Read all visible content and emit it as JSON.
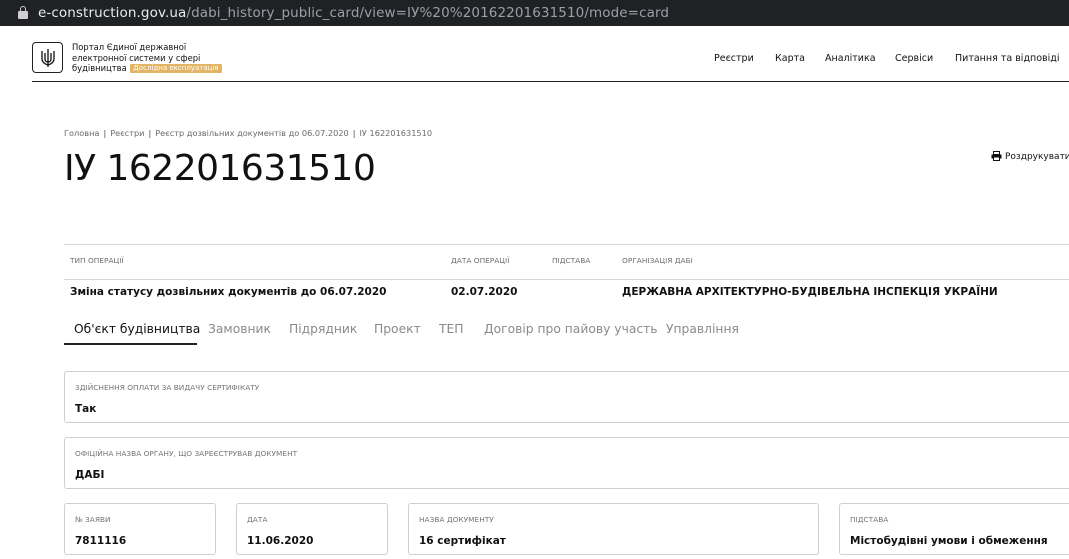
{
  "browser": {
    "url_host": "e-construction.gov.ua",
    "url_path": "/dabi_history_public_card/view=ІУ%20%2016220163151​0/mode=card"
  },
  "header": {
    "brand_line1": "Портал Єдиної державної",
    "brand_line2": "електронної системи у сфері",
    "brand_line3": "будівництва",
    "badge": "Дослідна експлуатація",
    "nav": [
      "Реєстри",
      "Карта",
      "Аналітика",
      "Сервіси",
      "Питання та відповіді"
    ]
  },
  "breadcrumbs": [
    "Головна",
    "Реєстри",
    "Реєстр дозвільних документів до 06.07.2020",
    "ІУ 162201631510"
  ],
  "page_title": "ІУ 162201631510",
  "print_label": "Роздрукувати",
  "operation": {
    "headers": [
      "ТИП ОПЕРАЦІЇ",
      "ДАТА ОПЕРАЦІЇ",
      "ПІДСТАВА",
      "ОРГАНІЗАЦІЯ ДАБІ"
    ],
    "type": "Зміна статусу дозвільних документів до 06.07.2020",
    "date": "02.07.2020",
    "basis": "",
    "organization": "ДЕРЖАВНА АРХІТЕКТУРНО-БУДІВЕЛЬНА ІНСПЕКЦІЯ УКРАЇНИ"
  },
  "tabs": [
    "Об'єкт будівництва",
    "Замовник",
    "Підрядник",
    "Проект",
    "ТЕП",
    "Договір про пайову участь",
    "Управління"
  ],
  "fields": {
    "payment_label": "ЗДІЙСНЕННЯ ОПЛАТИ ЗА ВИДАЧУ СЕРТИФІКАТУ",
    "payment_value": "Так",
    "authority_label": "ОФІЦІЙНА НАЗВА ОРГАНУ, ЩО ЗАРЕЄСТРУВАВ ДОКУМЕНТ",
    "authority_value": "ДАБІ",
    "app_no_label": "№ ЗАЯВИ",
    "app_no_value": "7811116",
    "date_label": "ДАТА",
    "date_value": "11.06.2020",
    "doc_name_label": "НАЗВА ДОКУМЕНТУ",
    "doc_name_value": "16 сертифікат",
    "basis_label": "ПІДСТАВА",
    "basis_value": "Містобудівні умови і обмеження"
  },
  "colors": {
    "badge": "#e2b566",
    "addressbar": "#202124"
  }
}
